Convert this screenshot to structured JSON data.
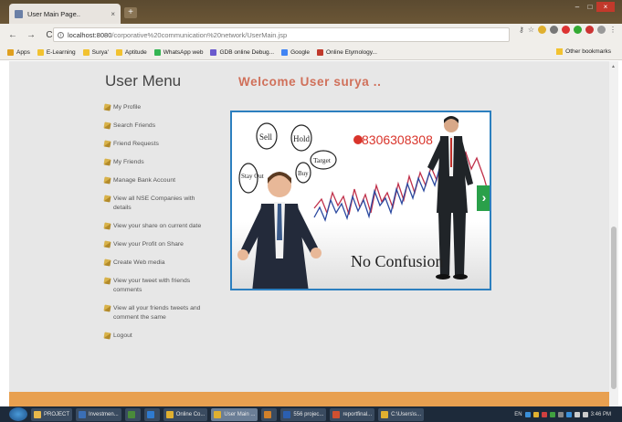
{
  "browser": {
    "tab_title": "User Main Page..",
    "tab_close": "×",
    "new_tab": "+",
    "window_controls": [
      "–",
      "□",
      "×"
    ],
    "nav": {
      "back": "←",
      "forward": "→",
      "reload": "C"
    },
    "url_host": "localhost:8080",
    "url_path": "/corporative%20communication%20network/UserMain.jsp",
    "bookmarks": [
      {
        "label": "Apps",
        "color": "#e0a020"
      },
      {
        "label": "E-Learning",
        "color": "#f2c230"
      },
      {
        "label": "Surya'",
        "color": "#f2c230"
      },
      {
        "label": "Aptitude",
        "color": "#f2c230"
      },
      {
        "label": "WhatsApp web",
        "color": "#34b553"
      },
      {
        "label": "GDB online Debug...",
        "color": "#6a5acd"
      },
      {
        "label": "Google",
        "color": "#4285f4"
      },
      {
        "label": "Online Etymology...",
        "color": "#c0392b"
      }
    ],
    "other_bookmarks": "Other bookmarks"
  },
  "page": {
    "menu_title": "User Menu",
    "welcome": "Welcome User surya ..",
    "menu_items": [
      "My Profile",
      "Search Friends",
      "Friend Requests",
      "My Friends",
      "Manage Bank Account",
      "View all NSE Companies with details",
      "View your share on current date",
      "View your Profit on Share",
      "Create Web media",
      "View your tweet with friends comments",
      "View all your friends tweets and comment the same",
      "Logout"
    ],
    "banner": {
      "phone": "8306308308",
      "caption": "No Confusion",
      "bubbles": [
        "Sell",
        "Hold",
        "Target",
        "Stay Out",
        "Buy"
      ],
      "next_arrow": "›"
    }
  },
  "taskbar": {
    "items": [
      {
        "label": "PROJECT",
        "color": "#e8b84a"
      },
      {
        "label": "Investmen...",
        "color": "#3b6fb6"
      },
      {
        "label": "",
        "color": "#4a8a3a"
      },
      {
        "label": "",
        "color": "#2f7bd0"
      },
      {
        "label": "Online Co...",
        "color": "#e0b030"
      },
      {
        "label": "User Main ...",
        "color": "#e0b030",
        "active": true
      },
      {
        "label": "",
        "color": "#d0802a"
      },
      {
        "label": "556 projec...",
        "color": "#2b5fb0"
      },
      {
        "label": "reportfinal...",
        "color": "#d05030"
      },
      {
        "label": "C:\\Users\\s...",
        "color": "#e0b030"
      }
    ],
    "tray_lang": "EN",
    "clock": "3:46 PM"
  },
  "colors": {
    "welcome": "#d0705a",
    "footer": "#e8a050",
    "banner_border": "#2c7fbf",
    "phone": "#d9342b"
  }
}
